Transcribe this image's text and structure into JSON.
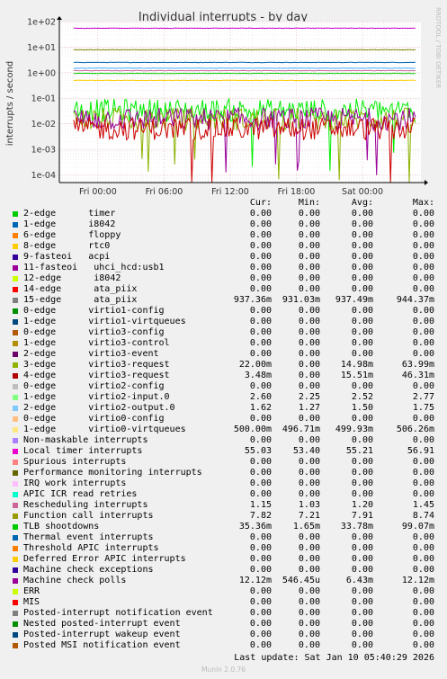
{
  "chart_data": {
    "type": "line",
    "title": "Individual interrupts - by day",
    "ylabel": "interrupts / second",
    "side_label": "RRDTOOL / TOBI OETIKER",
    "yscale": "log",
    "ylim": [
      5e-05,
      100
    ],
    "y_ticks": [
      "1e+02",
      "1e+01",
      "1e+00",
      "1e-01",
      "1e-02",
      "1e-03",
      "1e-04"
    ],
    "y_tick_values": [
      100,
      10,
      1,
      0.1,
      0.01,
      0.001,
      0.0001
    ],
    "x_ticks": [
      "Fri 00:00",
      "Fri 06:00",
      "Fri 12:00",
      "Fri 18:00",
      "Sat 00:00"
    ],
    "x_tick_hours": [
      0,
      6,
      12,
      18,
      24
    ],
    "xlim_hours": [
      -3.5,
      29.3
    ],
    "series": [
      {
        "name": "15-edge ata_piix",
        "color": "#00cc00",
        "level": 0.937,
        "noise": 0
      },
      {
        "name": "1-edge virtio0-virtqueues",
        "color": "#ffcc00",
        "level": 0.5,
        "noise": 0
      },
      {
        "name": "Local timer interrupts",
        "color": "#cc00cc",
        "level": 55.0,
        "noise": 0
      },
      {
        "name": "1-edge virtio2-input.0",
        "color": "#0066b3",
        "level": 2.52,
        "noise": 0
      },
      {
        "name": "2-edge virtio2-output.0",
        "color": "#44aaff",
        "level": 1.5,
        "noise": 0
      },
      {
        "name": "Rescheduling interrupts",
        "color": "#cc6699",
        "level": 1.2,
        "noise": 0
      },
      {
        "name": "Function call interrupts",
        "color": "#808000",
        "level": 7.91,
        "noise": 0
      },
      {
        "name": "TLB shootdowns",
        "color": "#00ee00",
        "level": 0.03378,
        "noise": 1
      },
      {
        "name": "3-edge virtio3-request",
        "color": "#8cb200",
        "level": 0.01498,
        "noise": 1
      },
      {
        "name": "4-edge virtio3-request",
        "color": "#990099",
        "level": 0.01551,
        "noise": 1
      },
      {
        "name": "Machine check polls",
        "color": "#cc0000",
        "level": 0.00643,
        "noise": 1
      }
    ]
  },
  "legend": {
    "headers": [
      "Cur:",
      "Min:",
      "Avg:",
      "Max:"
    ],
    "rows": [
      {
        "label": "2-edge      timer",
        "color": "#00cc00",
        "cur": "0.00",
        "min": "0.00",
        "avg": "0.00",
        "max": "0.00"
      },
      {
        "label": "1-edge      i8042",
        "color": "#0066b3",
        "cur": "0.00",
        "min": "0.00",
        "avg": "0.00",
        "max": "0.00"
      },
      {
        "label": "6-edge      floppy",
        "color": "#ff8000",
        "cur": "0.00",
        "min": "0.00",
        "avg": "0.00",
        "max": "0.00"
      },
      {
        "label": "8-edge      rtc0",
        "color": "#ffcc00",
        "cur": "0.00",
        "min": "0.00",
        "avg": "0.00",
        "max": "0.00"
      },
      {
        "label": "9-fasteoi   acpi",
        "color": "#330099",
        "cur": "0.00",
        "min": "0.00",
        "avg": "0.00",
        "max": "0.00"
      },
      {
        "label": "11-fasteoi   uhci_hcd:usb1",
        "color": "#990099",
        "cur": "0.00",
        "min": "0.00",
        "avg": "0.00",
        "max": "0.00"
      },
      {
        "label": "12-edge      i8042",
        "color": "#ccff00",
        "cur": "0.00",
        "min": "0.00",
        "avg": "0.00",
        "max": "0.00"
      },
      {
        "label": "14-edge      ata_piix",
        "color": "#ff0000",
        "cur": "0.00",
        "min": "0.00",
        "avg": "0.00",
        "max": "0.00"
      },
      {
        "label": "15-edge      ata_piix",
        "color": "#808080",
        "cur": "937.36m",
        "min": "931.03m",
        "avg": "937.49m",
        "max": "944.37m"
      },
      {
        "label": "0-edge      virtio1-config",
        "color": "#008f00",
        "cur": "0.00",
        "min": "0.00",
        "avg": "0.00",
        "max": "0.00"
      },
      {
        "label": "1-edge      virtio1-virtqueues",
        "color": "#00487d",
        "cur": "0.00",
        "min": "0.00",
        "avg": "0.00",
        "max": "0.00"
      },
      {
        "label": "0-edge      virtio3-config",
        "color": "#b35a00",
        "cur": "0.00",
        "min": "0.00",
        "avg": "0.00",
        "max": "0.00"
      },
      {
        "label": "1-edge      virtio3-control",
        "color": "#b38f00",
        "cur": "0.00",
        "min": "0.00",
        "avg": "0.00",
        "max": "0.00"
      },
      {
        "label": "2-edge      virtio3-event",
        "color": "#6b006b",
        "cur": "0.00",
        "min": "0.00",
        "avg": "0.00",
        "max": "0.00"
      },
      {
        "label": "3-edge      virtio3-request",
        "color": "#8fb300",
        "cur": "22.00m",
        "min": "0.00",
        "avg": "14.98m",
        "max": "63.99m"
      },
      {
        "label": "4-edge      virtio3-request",
        "color": "#b30000",
        "cur": "3.48m",
        "min": "0.00",
        "avg": "15.51m",
        "max": "46.31m"
      },
      {
        "label": "0-edge      virtio2-config",
        "color": "#bebebe",
        "cur": "0.00",
        "min": "0.00",
        "avg": "0.00",
        "max": "0.00"
      },
      {
        "label": "1-edge      virtio2-input.0",
        "color": "#80ff80",
        "cur": "2.60",
        "min": "2.25",
        "avg": "2.52",
        "max": "2.77"
      },
      {
        "label": "2-edge      virtio2-output.0",
        "color": "#80c9ff",
        "cur": "1.62",
        "min": "1.27",
        "avg": "1.50",
        "max": "1.75"
      },
      {
        "label": "0-edge      virtio0-config",
        "color": "#ffc080",
        "cur": "0.00",
        "min": "0.00",
        "avg": "0.00",
        "max": "0.00"
      },
      {
        "label": "1-edge      virtio0-virtqueues",
        "color": "#ffe680",
        "cur": "500.00m",
        "min": "496.71m",
        "avg": "499.93m",
        "max": "506.26m"
      },
      {
        "label": "Non-maskable interrupts",
        "color": "#aa80ff",
        "cur": "0.00",
        "min": "0.00",
        "avg": "0.00",
        "max": "0.00"
      },
      {
        "label": "Local timer interrupts",
        "color": "#ee00cc",
        "cur": "55.03",
        "min": "53.40",
        "avg": "55.21",
        "max": "56.91"
      },
      {
        "label": "Spurious interrupts",
        "color": "#ff8080",
        "cur": "0.00",
        "min": "0.00",
        "avg": "0.00",
        "max": "0.00"
      },
      {
        "label": "Performance monitoring interrupts",
        "color": "#666600",
        "cur": "0.00",
        "min": "0.00",
        "avg": "0.00",
        "max": "0.00"
      },
      {
        "label": "IRQ work interrupts",
        "color": "#ffbfff",
        "cur": "0.00",
        "min": "0.00",
        "avg": "0.00",
        "max": "0.00"
      },
      {
        "label": "APIC ICR read retries",
        "color": "#00ffcc",
        "cur": "0.00",
        "min": "0.00",
        "avg": "0.00",
        "max": "0.00"
      },
      {
        "label": "Rescheduling interrupts",
        "color": "#cc6699",
        "cur": "1.15",
        "min": "1.03",
        "avg": "1.20",
        "max": "1.45"
      },
      {
        "label": "Function call interrupts",
        "color": "#999900",
        "cur": "7.82",
        "min": "7.21",
        "avg": "7.91",
        "max": "8.74"
      },
      {
        "label": "TLB shootdowns",
        "color": "#00cc00",
        "cur": "35.36m",
        "min": "1.65m",
        "avg": "33.78m",
        "max": "99.07m"
      },
      {
        "label": "Thermal event interrupts",
        "color": "#0066b3",
        "cur": "0.00",
        "min": "0.00",
        "avg": "0.00",
        "max": "0.00"
      },
      {
        "label": "Threshold APIC interrupts",
        "color": "#ff8000",
        "cur": "0.00",
        "min": "0.00",
        "avg": "0.00",
        "max": "0.00"
      },
      {
        "label": "Deferred Error APIC interrupts",
        "color": "#ffcc00",
        "cur": "0.00",
        "min": "0.00",
        "avg": "0.00",
        "max": "0.00"
      },
      {
        "label": "Machine check exceptions",
        "color": "#330099",
        "cur": "0.00",
        "min": "0.00",
        "avg": "0.00",
        "max": "0.00"
      },
      {
        "label": "Machine check polls",
        "color": "#990099",
        "cur": "12.12m",
        "min": "546.45u",
        "avg": "6.43m",
        "max": "12.12m"
      },
      {
        "label": "ERR",
        "color": "#ccff00",
        "cur": "0.00",
        "min": "0.00",
        "avg": "0.00",
        "max": "0.00"
      },
      {
        "label": "MIS",
        "color": "#ff0000",
        "cur": "0.00",
        "min": "0.00",
        "avg": "0.00",
        "max": "0.00"
      },
      {
        "label": "Posted-interrupt notification event",
        "color": "#808080",
        "cur": "0.00",
        "min": "0.00",
        "avg": "0.00",
        "max": "0.00"
      },
      {
        "label": "Nested posted-interrupt event",
        "color": "#008f00",
        "cur": "0.00",
        "min": "0.00",
        "avg": "0.00",
        "max": "0.00"
      },
      {
        "label": "Posted-interrupt wakeup event",
        "color": "#00487d",
        "cur": "0.00",
        "min": "0.00",
        "avg": "0.00",
        "max": "0.00"
      },
      {
        "label": "Posted MSI notification event",
        "color": "#b35a00",
        "cur": "0.00",
        "min": "0.00",
        "avg": "0.00",
        "max": "0.00"
      }
    ]
  },
  "last_update": "Last update: Sat Jan 10 05:40:29 2026",
  "footer": "Munin 2.0.76"
}
